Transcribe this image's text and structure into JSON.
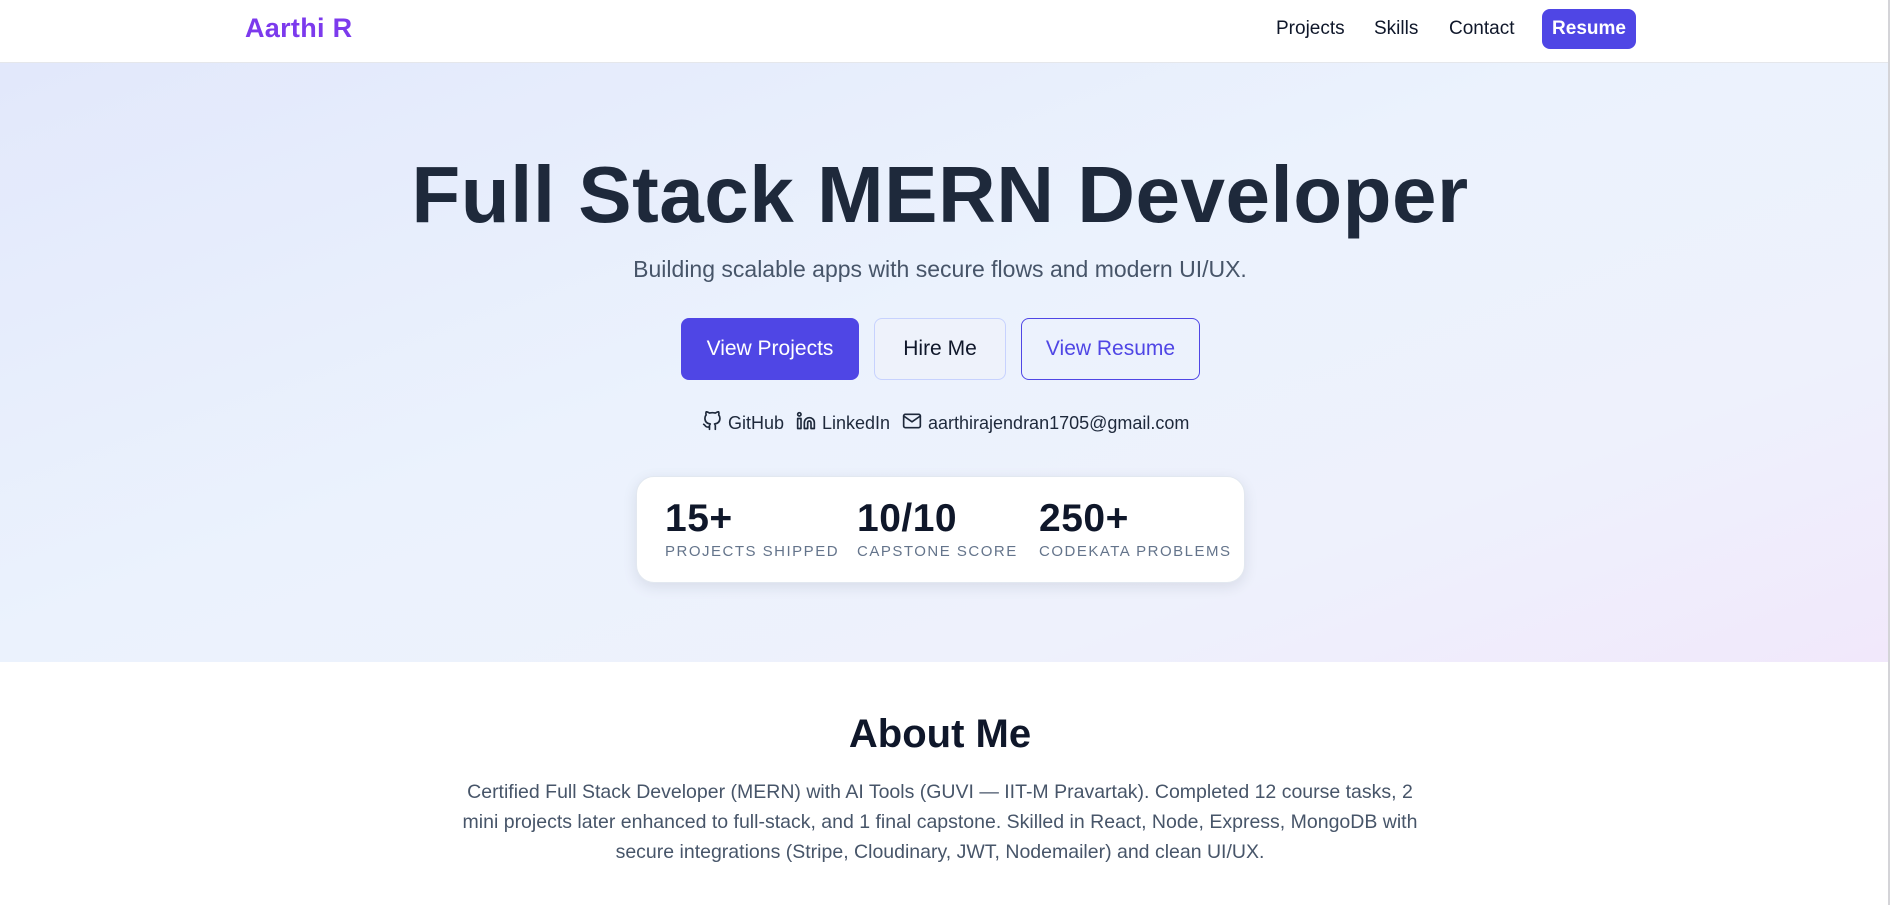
{
  "nav": {
    "brand": "Aarthi R",
    "links": [
      {
        "label": "Projects"
      },
      {
        "label": "Skills"
      },
      {
        "label": "Contact"
      }
    ],
    "resume_label": "Resume"
  },
  "hero": {
    "title": "Full Stack MERN Developer",
    "subtitle": "Building scalable apps with secure flows and modern UI/UX.",
    "buttons": {
      "primary": "View Projects",
      "secondary": "Hire Me",
      "outline": "View Resume"
    },
    "contacts": {
      "github": "GitHub",
      "linkedin": "LinkedIn",
      "email": "aarthirajendran1705@gmail.com"
    },
    "stats": [
      {
        "value": "15+",
        "label": "PROJECTS SHIPPED"
      },
      {
        "value": "10/10",
        "label": "CAPSTONE SCORE"
      },
      {
        "value": "250+",
        "label": "CODEKATA PROBLEMS"
      }
    ]
  },
  "about": {
    "title": "About Me",
    "text": "Certified Full Stack Developer (MERN) with AI Tools (GUVI — IIT-M Pravartak). Completed 12 course tasks, 2 mini projects later enhanced to full-stack, and 1 final capstone. Skilled in React, Node, Express, MongoDB with secure integrations (Stripe, Cloudinary, JWT, Nodemailer) and clean UI/UX."
  },
  "colors": {
    "accent": "#4f46e5",
    "brand": "#7c3aed",
    "heading": "#1e293b",
    "muted": "#475569"
  }
}
